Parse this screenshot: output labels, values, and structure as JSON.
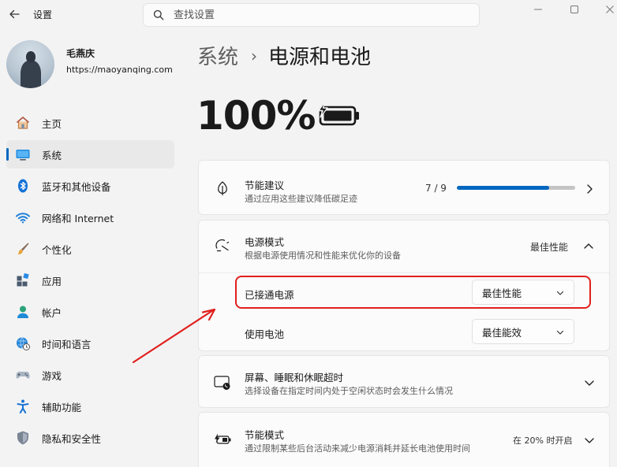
{
  "window": {
    "title": "设置"
  },
  "search": {
    "placeholder": "查找设置"
  },
  "profile": {
    "name": "毛燕庆",
    "website": "https://maoyanqing.com"
  },
  "sidebar": {
    "items": [
      {
        "label": "主页",
        "icon": "home-icon"
      },
      {
        "label": "系统",
        "icon": "system-icon",
        "active": true
      },
      {
        "label": "蓝牙和其他设备",
        "icon": "bluetooth-icon"
      },
      {
        "label": "网络和 Internet",
        "icon": "wifi-icon"
      },
      {
        "label": "个性化",
        "icon": "brush-icon"
      },
      {
        "label": "应用",
        "icon": "apps-icon"
      },
      {
        "label": "帐户",
        "icon": "account-icon"
      },
      {
        "label": "时间和语言",
        "icon": "globe-clock-icon"
      },
      {
        "label": "游戏",
        "icon": "gamepad-icon"
      },
      {
        "label": "辅助功能",
        "icon": "accessibility-icon"
      },
      {
        "label": "隐私和安全性",
        "icon": "shield-icon"
      }
    ]
  },
  "breadcrumb": {
    "parent": "系统",
    "separator": "›",
    "current": "电源和电池"
  },
  "battery": {
    "percent": "100%",
    "charging": true
  },
  "energy_recommendations": {
    "title": "节能建议",
    "subtitle": "通过应用这些建议降低碳足迹",
    "progress_text": "7 / 9",
    "progress_fraction": 0.78
  },
  "power_mode": {
    "title": "电源模式",
    "subtitle": "根据电源使用情况和性能来优化你的设备",
    "current_value": "最佳性能",
    "plugged_in": {
      "label": "已接通电源",
      "value": "最佳性能"
    },
    "on_battery": {
      "label": "使用电池",
      "value": "最佳能效"
    }
  },
  "screen_sleep": {
    "title": "屏幕、睡眠和休眠超时",
    "subtitle": "选择设备在指定时间内处于空闲状态时会发生什么情况"
  },
  "battery_saver": {
    "title": "节能模式",
    "subtitle": "通过限制某些后台活动来减少电源消耗并延长电池使用时间",
    "value": "在 20% 时开启"
  },
  "colors": {
    "accent": "#0067c0",
    "annotation": "#e0201d"
  }
}
